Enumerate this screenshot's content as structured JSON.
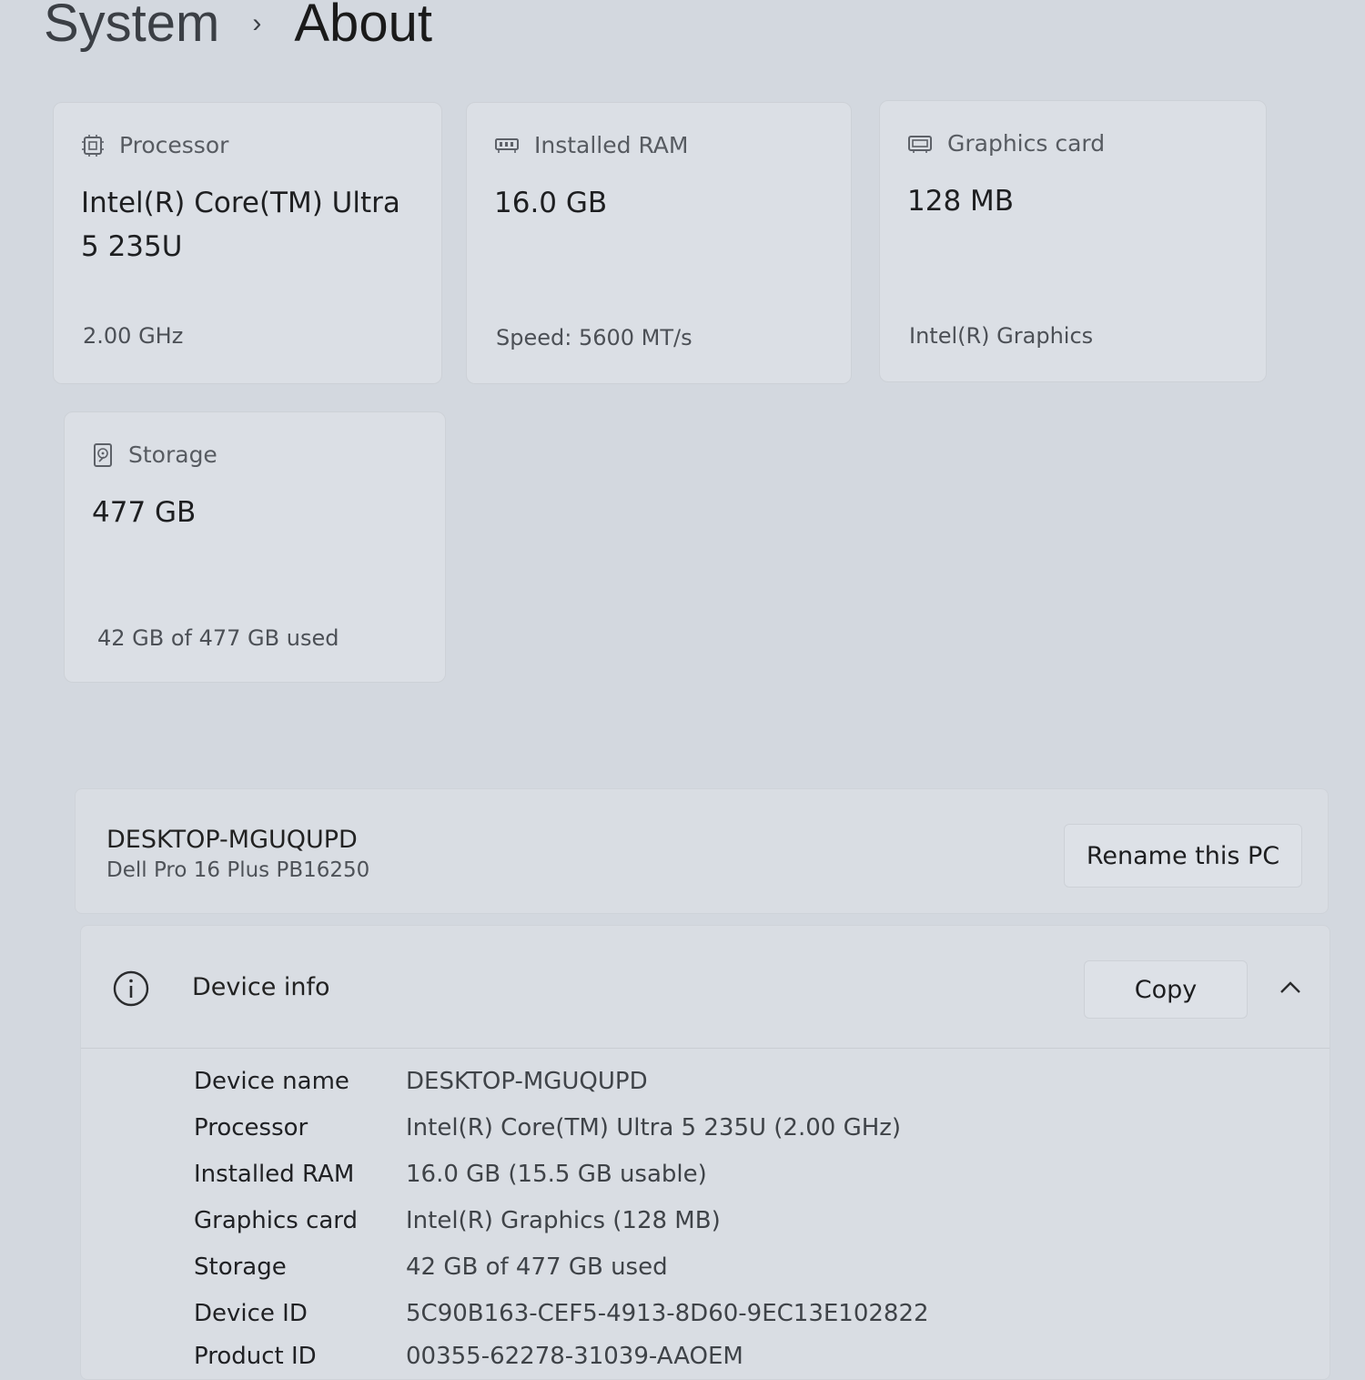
{
  "breadcrumb": {
    "parent": "System",
    "separator": "›",
    "current": "About"
  },
  "cards": {
    "processor": {
      "title": "Processor",
      "value": "Intel(R) Core(TM) Ultra 5 235U",
      "sub": "2.00 GHz",
      "icon": "processor-icon"
    },
    "ram": {
      "title": "Installed RAM",
      "value": "16.0 GB",
      "sub": "Speed: 5600 MT/s",
      "icon": "ram-icon"
    },
    "graphics": {
      "title": "Graphics card",
      "value": "128 MB",
      "sub": "Intel(R) Graphics",
      "icon": "graphics-card-icon"
    },
    "storage": {
      "title": "Storage",
      "value": "477 GB",
      "sub": "42 GB of 477 GB used",
      "icon": "storage-icon"
    }
  },
  "pc": {
    "name": "DESKTOP-MGUQUPD",
    "model": "Dell Pro 16 Plus PB16250",
    "rename_label": "Rename this PC"
  },
  "device_info": {
    "title": "Device info",
    "copy_label": "Copy",
    "rows": [
      {
        "label": "Device name",
        "value": "DESKTOP-MGUQUPD"
      },
      {
        "label": "Processor",
        "value": "Intel(R) Core(TM) Ultra 5 235U (2.00 GHz)"
      },
      {
        "label": "Installed RAM",
        "value": "16.0 GB (15.5 GB usable)"
      },
      {
        "label": "Graphics card",
        "value": "Intel(R) Graphics (128 MB)"
      },
      {
        "label": "Storage",
        "value": "42 GB of 477 GB used"
      },
      {
        "label": "Device ID",
        "value": "5C90B163-CEF5-4913-8D60-9EC13E102822"
      },
      {
        "label": "Product ID",
        "value": "00355-62278-31039-AAOEM"
      }
    ]
  },
  "colors": {
    "background": "#d3d8df",
    "card": "#dbdfe5",
    "text": "#1b1b1b"
  }
}
